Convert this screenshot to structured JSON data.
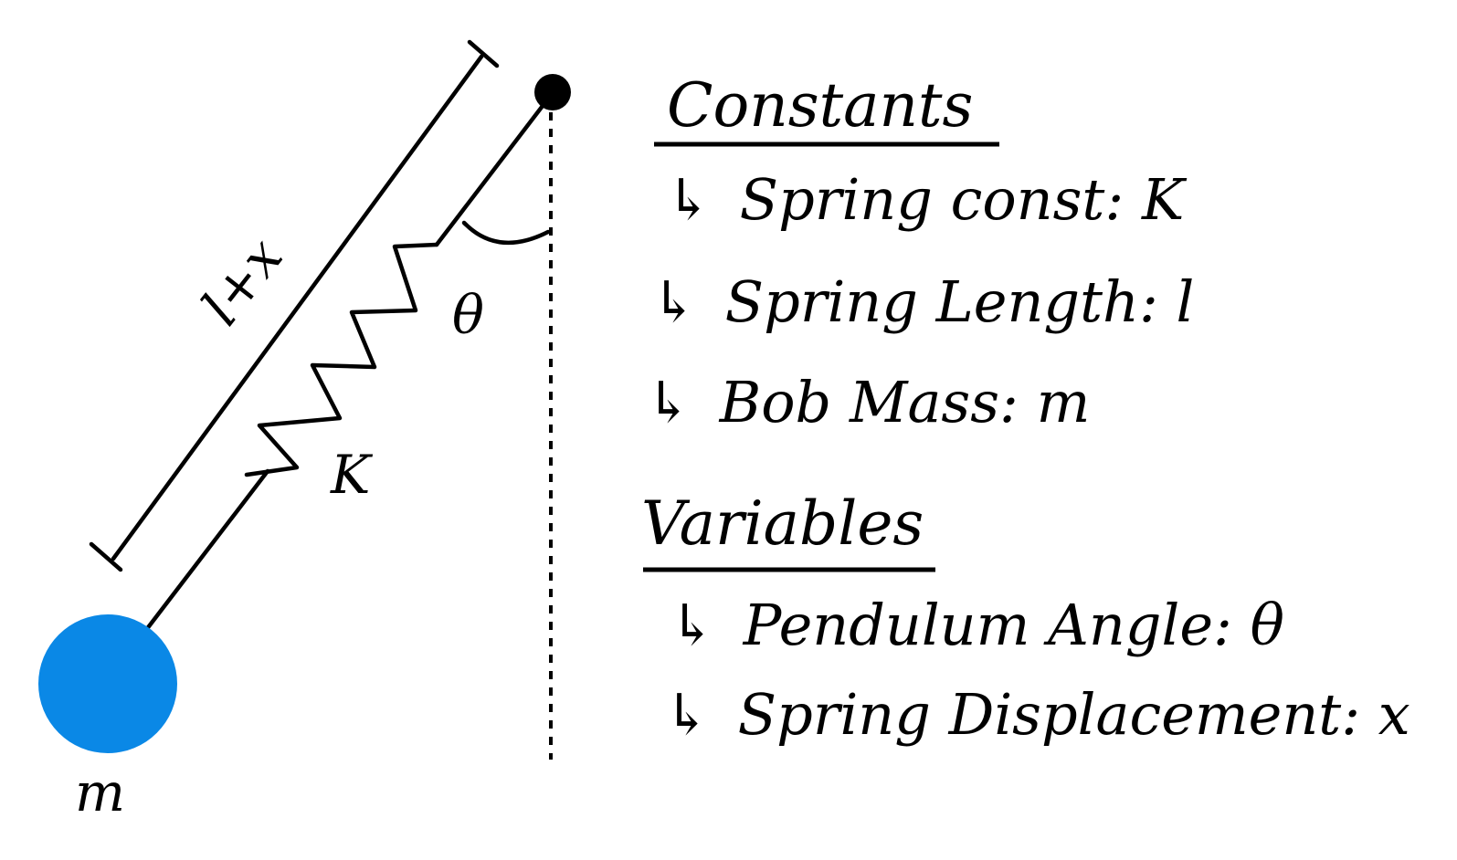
{
  "diagram": {
    "labels": {
      "length": "l+x",
      "spring_constant": "K",
      "angle": "θ",
      "mass": "m"
    },
    "colors": {
      "bob": "#0a88e6",
      "ink": "#000000"
    },
    "constants": {
      "heading": "Constants",
      "items": [
        {
          "arrow": "↳",
          "text": "Spring const: K"
        },
        {
          "arrow": "↳",
          "text": "Spring Length: l"
        },
        {
          "arrow": "↳",
          "text": "Bob  Mass: m"
        }
      ]
    },
    "variables": {
      "heading": "Variables",
      "items": [
        {
          "arrow": "↳",
          "text": "Pendulum Angle: θ"
        },
        {
          "arrow": "↳",
          "text": "Spring Displacement: x"
        }
      ]
    }
  }
}
